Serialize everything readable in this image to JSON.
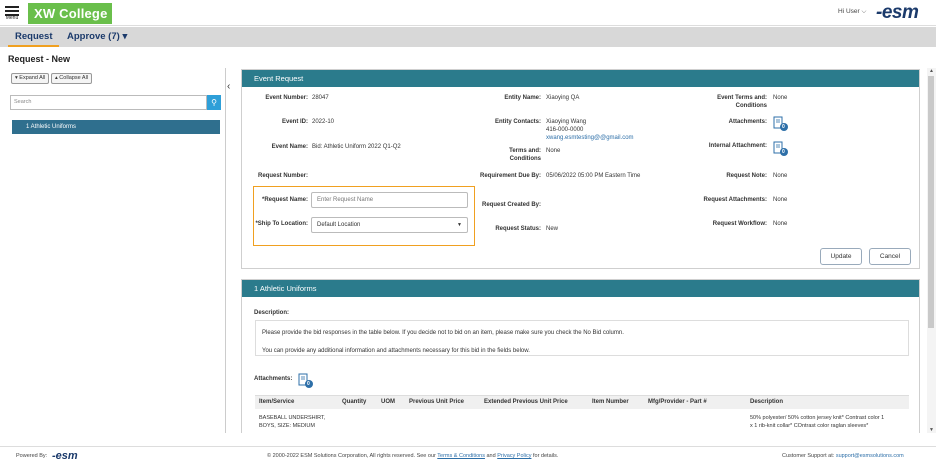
{
  "menu": {
    "label": "Menu"
  },
  "brand": {
    "logo_text": "XW College",
    "esm_logo": "-esm",
    "accent": "#6abf4b"
  },
  "header": {
    "greeting": "Hi User"
  },
  "tabs": [
    {
      "label": "Request",
      "active": true
    },
    {
      "label": "Approve (7)",
      "suffix": "▾"
    }
  ],
  "page": {
    "title": "Request - New"
  },
  "sidebar": {
    "expand_all": "Expand All",
    "collapse_all": "Collapse All",
    "search_placeholder": "Search",
    "items": [
      "1 Athletic Uniforms"
    ]
  },
  "event": {
    "header": "Event Request",
    "labels": {
      "event_number": "Event Number:",
      "event_id": "Event ID:",
      "event_name": "Event Name:",
      "request_number": "Request Number:",
      "request_name": "*Request Name:",
      "ship_to": "*Ship To Location:",
      "entity_name": "Entity Name:",
      "entity_contacts": "Entity Contacts:",
      "terms_1": "Terms and:",
      "terms_2": "Conditions",
      "requirement_due": "Requirement Due By:",
      "request_created": "Request Created By:",
      "request_status": "Request Status:",
      "event_terms_1": "Event Terms and:",
      "event_terms_2": "Conditions",
      "attachments": "Attachments:",
      "internal_attachment": "Internal Attachment:",
      "request_note": "Request Note:",
      "request_attachments": "Request Attachments:",
      "request_workflow": "Request Workflow:"
    },
    "values": {
      "event_number": "28047",
      "event_id": "2022-10",
      "event_name": "Bid: Athletic Uniform 2022 Q1-Q2",
      "entity_name": "Xiaoying QA",
      "contact_name": "Xiaoying Wang",
      "contact_phone": "416-000-0000",
      "contact_email": "xwang.esmtesting@@gmail.com",
      "terms": "None",
      "requirement_due": "05/06/2022 05:00 PM Eastern Time",
      "request_status": "New",
      "event_terms": "None",
      "request_note": "None",
      "request_attachments": "None",
      "request_workflow": "None",
      "attach_count": "0",
      "internal_count": "0"
    },
    "request_name_placeholder": "Enter Request Name",
    "ship_to_value": "Default Location",
    "buttons": {
      "update": "Update",
      "cancel": "Cancel"
    }
  },
  "item": {
    "header": "1 Athletic Uniforms",
    "description_label": "Description:",
    "description_1": "Please provide the bid responses in the table below. If you decide not to bid on an item, please make sure you check the No Bid column.",
    "description_2": "You can provide any additional information and attachments necessary for this bid in the fields below.",
    "attachments_label": "Attachments:",
    "attach_count": "0",
    "columns": [
      "Item/Service",
      "Quantity",
      "UOM",
      "Previous Unit Price",
      "Extended Previous Unit Price",
      "Item Number",
      "Mfg/Provider - Part #",
      "Description"
    ],
    "row": {
      "item_1": "BASEBALL UNDERSHIRT,",
      "item_2": "BOYS, SIZE: MEDIUM",
      "desc_1": "50% polyester/ 50% cotton jersey knit* Contrast color 1",
      "desc_2": "x 1 rib-knit collar* COntrast color raglan sleeves*"
    }
  },
  "footer": {
    "powered_by": "Powered By:",
    "esm_logo": "-esm",
    "copyright": "© 2000-2022 ESM Solutions Corporation, All rights reserved. See our",
    "terms_link": "Terms & Conditions",
    "and": "and",
    "privacy_link": "Privacy Policy",
    "for_details": "for details.",
    "support_label": "Customer Support at:",
    "support_email": "support@esmsolutions.com"
  }
}
